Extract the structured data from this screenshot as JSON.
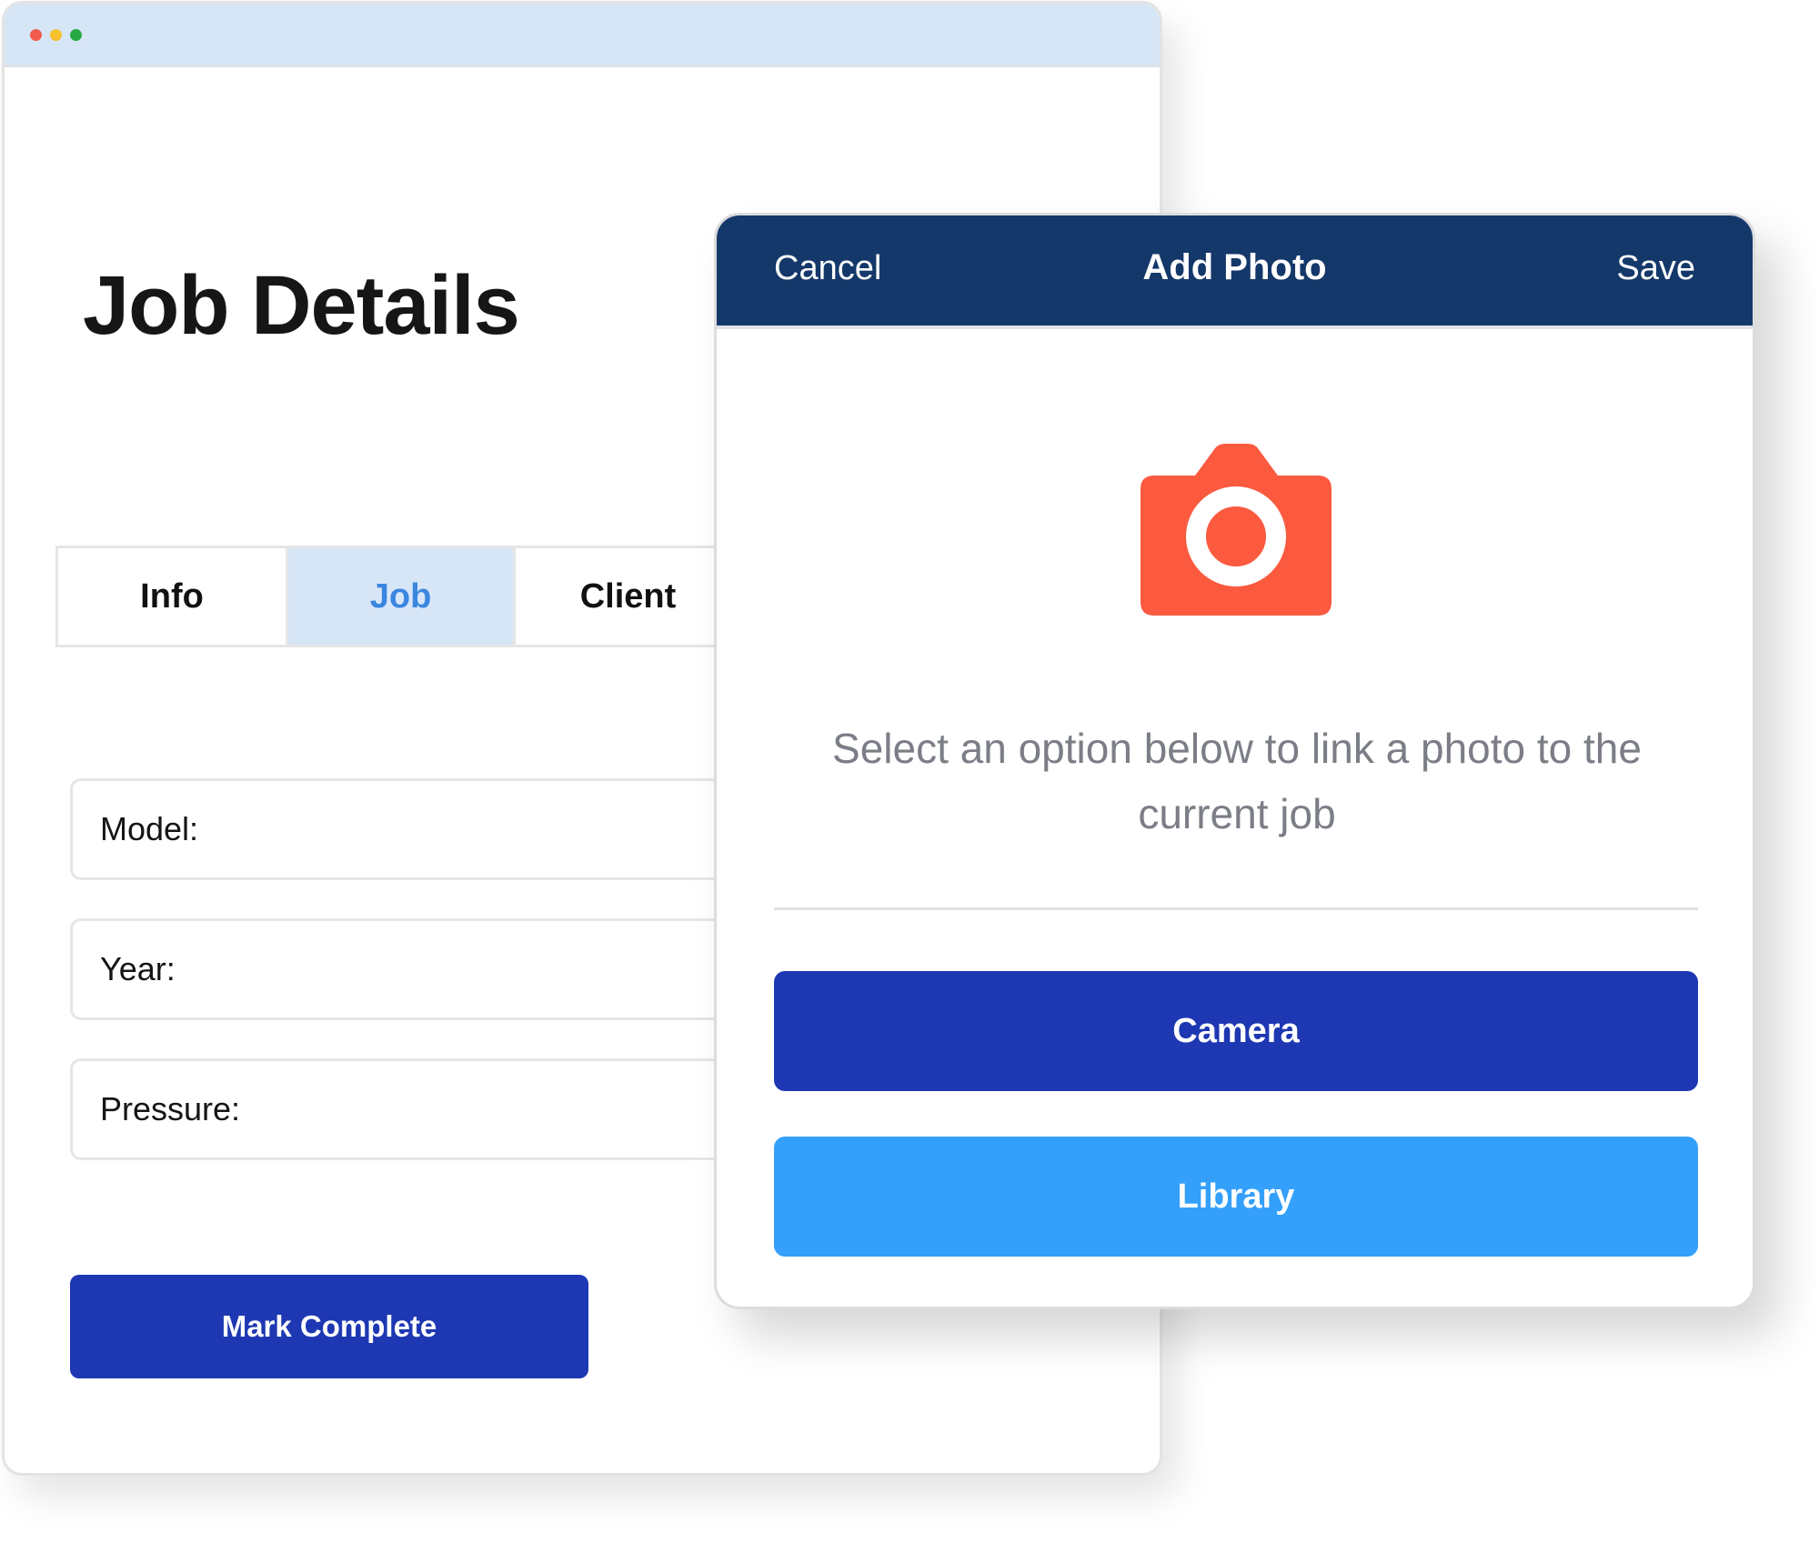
{
  "window": {
    "controls": [
      "close",
      "minimize",
      "maximize"
    ],
    "control_colors": [
      "#f25b4b",
      "#f6c02e",
      "#27a843"
    ],
    "titlebar_color": "#d7e6f7"
  },
  "page": {
    "title": "Job Details",
    "tabs": [
      {
        "label": "Info",
        "active": false
      },
      {
        "label": "Job",
        "active": true
      },
      {
        "label": "Client",
        "active": false
      }
    ],
    "fields": [
      {
        "label": "Model:",
        "value": ""
      },
      {
        "label": "Year:",
        "value": ""
      },
      {
        "label": "Pressure:",
        "value": ""
      }
    ],
    "mark_complete_label": "Mark Complete"
  },
  "modal": {
    "cancel_label": "Cancel",
    "title": "Add Photo",
    "save_label": "Save",
    "icon": "camera-icon",
    "icon_color": "#fb5a3f",
    "header_color": "#14386a",
    "message": "Select an option below to link a photo to the current job",
    "camera_label": "Camera",
    "library_label": "Library",
    "camera_color": "#1e38b3",
    "library_color": "#34a0fb"
  }
}
